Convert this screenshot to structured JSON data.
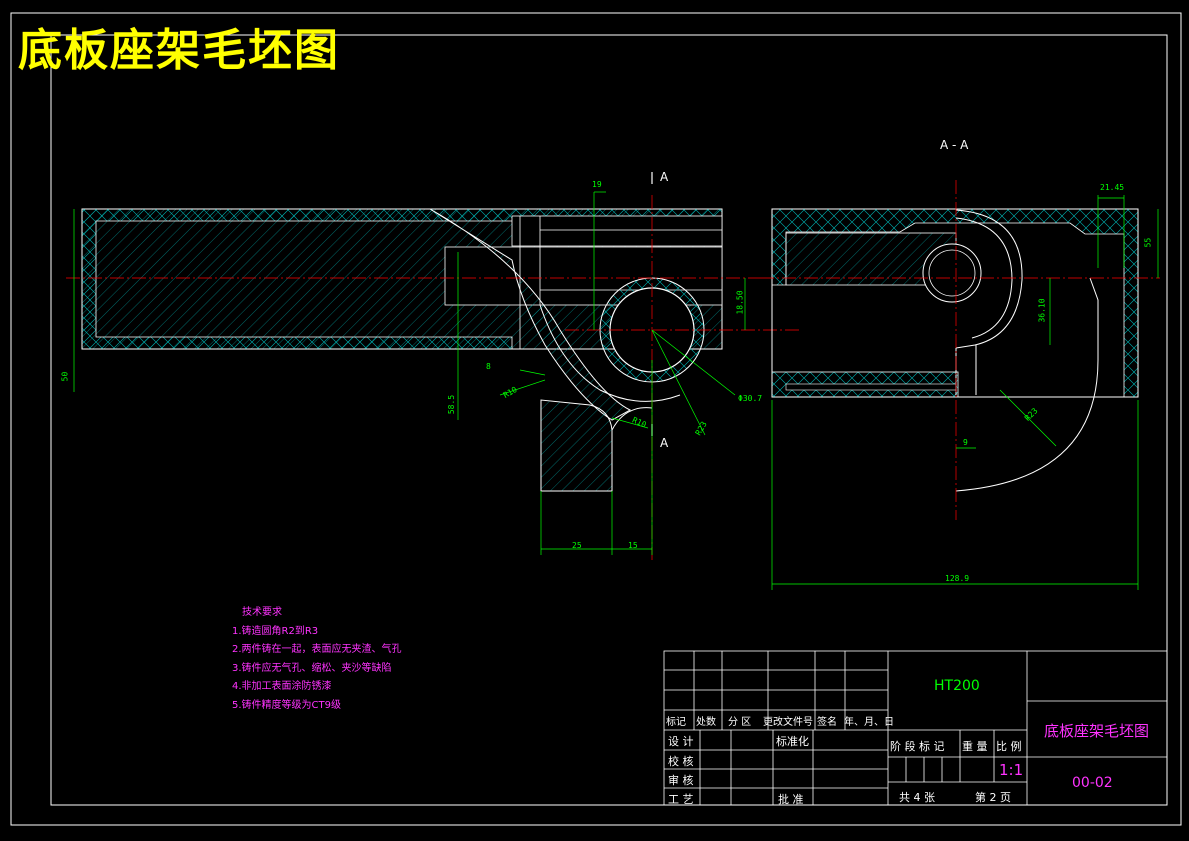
{
  "title": "底板座架毛坯图",
  "section": {
    "label": "A - A",
    "cut_top": "A",
    "cut_bottom": "A"
  },
  "dimensions": {
    "d19": "19",
    "d21_45": "21.45",
    "d55": "55",
    "d18_50": "18.50",
    "d36_10": "36.10",
    "d8": "8",
    "d9": "9",
    "d50": "50",
    "d58_5": "58.5",
    "d25": "25",
    "d15": "15",
    "r10": "R10",
    "r10b": "R10",
    "r23": "R23",
    "r23b": "R23",
    "phi30_7": "Φ30.7",
    "d128_9": "128.9"
  },
  "tech_requirements": {
    "heading": "技术要求",
    "items": [
      "1.铸造圆角R2到R3",
      "2.两件铸在一起，表面应无夹渣、气孔",
      "3.铸件应无气孔、缩松、夹沙等缺陷",
      "4.非加工表面涂防锈漆",
      "5.铸件精度等级为CT9级"
    ]
  },
  "title_block": {
    "material": "HT200",
    "part_name": "底板座架毛坯图",
    "drawing_no": "00-02",
    "scale": "1:1",
    "scale_label": "比 例",
    "stage_label": "阶 段 标 记",
    "weight_label": "重 量",
    "total_sheets": "共 4 张",
    "sheet_no": "第 2 页",
    "rev_headers": [
      "标记",
      "处数",
      "分 区",
      "更改文件号",
      "签名",
      "年、月、日"
    ],
    "design": "设 计",
    "standardize": "标准化",
    "check": "校 核",
    "review": "审 核",
    "process": "工 艺",
    "approve": "批 准"
  }
}
